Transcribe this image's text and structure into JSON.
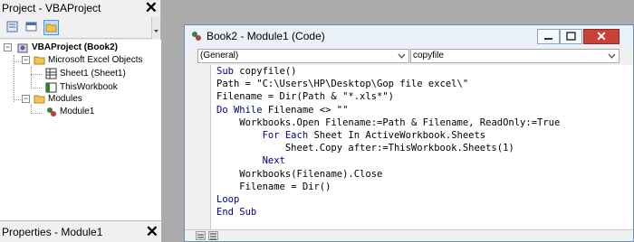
{
  "project_pane": {
    "title": "Project - VBAProject",
    "close_glyph": "✕",
    "toolbar": [
      {
        "icon": "view-code-icon"
      },
      {
        "icon": "view-object-icon"
      },
      {
        "icon": "toggle-folders-icon",
        "selected": true
      }
    ]
  },
  "tree": {
    "root": {
      "label": "VBAProject (Book2)",
      "icon": "vba-project-icon",
      "expander": "−"
    },
    "excel_objects": {
      "label": "Microsoft Excel Objects",
      "icon": "folder-icon",
      "expander": "−"
    },
    "sheet1": {
      "label": "Sheet1 (Sheet1)",
      "icon": "worksheet-icon"
    },
    "thisworkbook": {
      "label": "ThisWorkbook",
      "icon": "workbook-icon"
    },
    "modules": {
      "label": "Modules",
      "icon": "folder-icon",
      "expander": "−"
    },
    "module1": {
      "label": "Module1",
      "icon": "module-icon"
    }
  },
  "properties_pane": {
    "title": "Properties - Module1",
    "close_glyph": "✕"
  },
  "code_window": {
    "title": "Book2 - Module1 (Code)",
    "object_dropdown": "(General)",
    "procedure_dropdown": "copyfile",
    "close_glyph": "✕",
    "lines": [
      {
        "indent": "",
        "kw": "Sub",
        "rest": " copyfile()"
      },
      {
        "indent": "",
        "kw": "",
        "rest": "Path = \"C:\\Users\\HP\\Desktop\\Gop file excel\\\""
      },
      {
        "indent": "",
        "kw": "",
        "rest": "Filename = Dir(Path & \"*.xls*\")"
      },
      {
        "indent": "",
        "kw": "Do While",
        "rest": " Filename <> \"\""
      },
      {
        "indent": "    ",
        "kw": "",
        "rest": "Workbooks.Open Filename:=Path & Filename, ReadOnly:=True"
      },
      {
        "indent": "        ",
        "kw": "For Each",
        "rest": " Sheet In ActiveWorkbook.Sheets"
      },
      {
        "indent": "            ",
        "kw": "",
        "rest": "Sheet.Copy after:=ThisWorkbook.Sheets(1)"
      },
      {
        "indent": "        ",
        "kw": "Next",
        "rest": ""
      },
      {
        "indent": "    ",
        "kw": "",
        "rest": "Workbooks(Filename).Close"
      },
      {
        "indent": "    ",
        "kw": "",
        "rest": "Filename = Dir()"
      },
      {
        "indent": "",
        "kw": "Loop",
        "rest": ""
      },
      {
        "indent": "",
        "kw": "End Sub",
        "rest": ""
      }
    ]
  },
  "colors": {
    "keyword": "#00008b",
    "close_button": "#c9423a",
    "selection": "#3399ff"
  }
}
